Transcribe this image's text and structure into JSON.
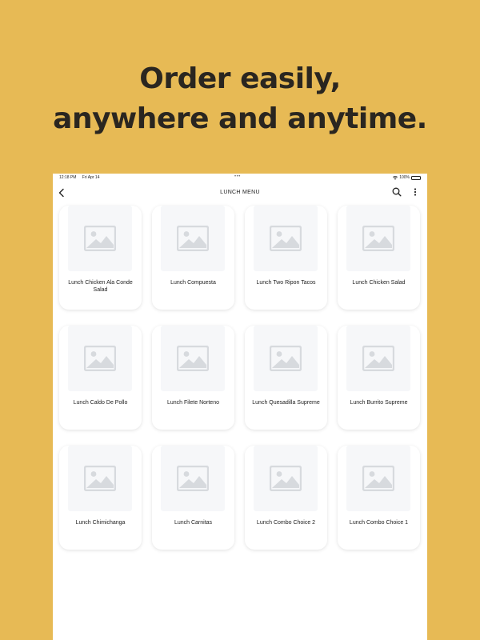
{
  "headline": {
    "line1": "Order easily,",
    "line2": "anywhere and anytime."
  },
  "status_bar": {
    "time": "12:18 PM",
    "date": "Fri Apr 14",
    "dots": "•••",
    "battery": "100%"
  },
  "nav": {
    "title": "LUNCH MENU"
  },
  "menu_items": [
    {
      "label": "Lunch Chicken Ala Conde Salad"
    },
    {
      "label": "Lunch Compuesta"
    },
    {
      "label": "Lunch Two Ripon Tacos"
    },
    {
      "label": "Lunch Chicken Salad"
    },
    {
      "label": "Lunch Caldo De Pollo"
    },
    {
      "label": "Lunch Filete Norteno"
    },
    {
      "label": "Lunch Quesadilla Supreme"
    },
    {
      "label": "Lunch Burrito Supreme"
    },
    {
      "label": "Lunch Chimichanga"
    },
    {
      "label": "Lunch Carnitas"
    },
    {
      "label": "Lunch Combo Choice 2"
    },
    {
      "label": "Lunch Combo Choice 1"
    }
  ],
  "colors": {
    "background": "#E7BA55",
    "headline": "#2A2620",
    "placeholder_bg": "#F6F7F9",
    "placeholder_icon": "#D7DADE"
  }
}
